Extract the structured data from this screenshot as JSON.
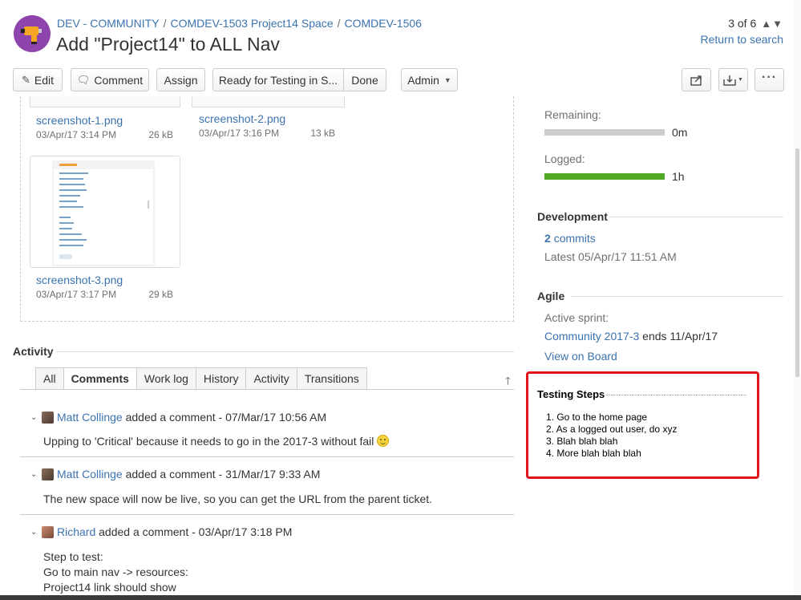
{
  "header": {
    "breadcrumb": [
      "DEV - COMMUNITY",
      "COMDEV-1503 Project14 Space",
      "COMDEV-1506"
    ],
    "title": "Add \"Project14\" to ALL Nav",
    "pager": "3 of 6",
    "return_to_search": "Return to search"
  },
  "toolbar": {
    "edit": "Edit",
    "comment": "Comment",
    "assign": "Assign",
    "ready_for_testing": "Ready for Testing in S...",
    "done": "Done",
    "admin": "Admin",
    "share_icon": "share-icon",
    "export_icon": "export-icon",
    "more_icon": "more-icon"
  },
  "attachments": [
    {
      "name": "screenshot-1.png",
      "date": "03/Apr/17 3:14 PM",
      "size": "26 kB"
    },
    {
      "name": "screenshot-2.png",
      "date": "03/Apr/17 3:16 PM",
      "size": "13 kB"
    },
    {
      "name": "screenshot-3.png",
      "date": "03/Apr/17 3:17 PM",
      "size": "29 kB"
    }
  ],
  "activity": {
    "label": "Activity",
    "tabs": [
      "All",
      "Comments",
      "Work log",
      "History",
      "Activity",
      "Transitions"
    ],
    "active_tab": "Comments",
    "comments": [
      {
        "author": "Matt Collinge",
        "action": "added a comment -",
        "date": "07/Mar/17 10:56 AM",
        "body": [
          "Upping to 'Critical' because it needs to go in the 2017-3 without fail"
        ]
      },
      {
        "author": "Matt Collinge",
        "action": "added a comment -",
        "date": "31/Mar/17 9:33 AM",
        "body": [
          "The new space will now be live, so you can get the URL from the parent ticket."
        ]
      },
      {
        "author": "Richard",
        "action": "added a comment -",
        "date": "03/Apr/17 3:18 PM",
        "body": [
          "Step to test:",
          "Go to main nav -> resources:",
          "Project14 link should show"
        ]
      }
    ]
  },
  "time_tracking": {
    "remaining_label": "Remaining:",
    "remaining_value": "0m",
    "remaining_fraction": 0,
    "logged_label": "Logged:",
    "logged_value": "1h",
    "logged_fraction": 1,
    "logged_color": "#51a825"
  },
  "development": {
    "heading": "Development",
    "commits_count": "2",
    "commits_label": "commits",
    "latest": "Latest 05/Apr/17 11:51 AM"
  },
  "agile": {
    "heading": "Agile",
    "active_sprint_label": "Active sprint:",
    "sprint_name": "Community 2017-3",
    "sprint_ends": "ends 11/Apr/17",
    "view_on_board": "View on Board"
  },
  "testing_steps": {
    "title": "Testing Steps",
    "steps": [
      "1. Go to the home page",
      "2. As a logged out user, do xyz",
      "3. Blah blah blah",
      "4. More blah blah blah"
    ],
    "highlight_color": "#e0141b"
  }
}
